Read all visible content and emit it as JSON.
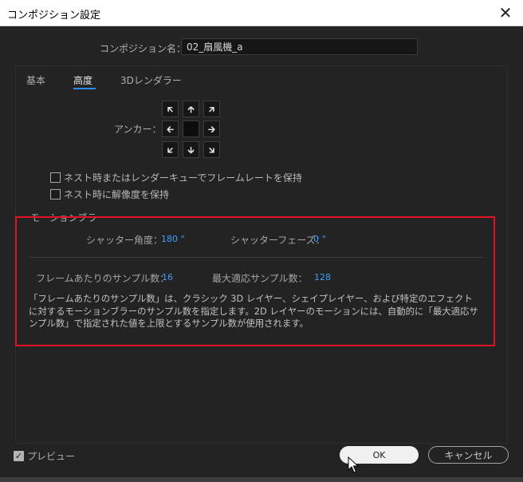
{
  "window": {
    "title": "コンポジション設定",
    "close_glyph": "✕"
  },
  "comp_name": {
    "label": "コンポジション名：",
    "value": "02_扇風機_a"
  },
  "tabs": [
    {
      "label": "基本"
    },
    {
      "label": "高度",
      "active": true
    },
    {
      "label": "3Dレンダラー"
    }
  ],
  "anchor": {
    "label": "アンカー：",
    "buttons": [
      {
        "glyph": "🡴",
        "icon": "arrow-up-left-icon"
      },
      {
        "glyph": "🡱",
        "icon": "arrow-up-icon"
      },
      {
        "glyph": "🡵",
        "icon": "arrow-up-right-icon"
      },
      {
        "glyph": "🡰",
        "icon": "arrow-left-icon"
      },
      {
        "glyph": "",
        "icon": "center-anchor"
      },
      {
        "glyph": "🡲",
        "icon": "arrow-right-icon"
      },
      {
        "glyph": "🡷",
        "icon": "arrow-down-left-icon"
      },
      {
        "glyph": "🡳",
        "icon": "arrow-down-icon"
      },
      {
        "glyph": "🡶",
        "icon": "arrow-down-right-icon"
      }
    ]
  },
  "options": {
    "preserve_frame_rate": "ネスト時またはレンダーキューでフレームレートを保持",
    "preserve_resolution": "ネスト時に解像度を保持"
  },
  "motion_blur": {
    "title": "モーションブラー",
    "shutter_angle_label": "シャッター角度：",
    "shutter_angle_value": "180 °",
    "shutter_phase_label": "シャッターフェーズ：",
    "shutter_phase_value": "0 °",
    "samples_per_frame_label": "フレームあたりのサンプル数：",
    "samples_per_frame_value": "16",
    "adaptive_limit_label": "最大適応サンプル数：",
    "adaptive_limit_value": "128",
    "description": "「フレームあたりのサンプル数」は、クラシック 3D レイヤー、シェイプレイヤー、および特定のエフェクトに対するモーションブラーのサンプル数を指定します。2D レイヤーのモーションには、自動的に「最大適応サンプル数」で指定された値を上限とするサンプル数が使用されます。"
  },
  "footer": {
    "preview_label": "プレビュー",
    "ok_label": "OK",
    "cancel_label": "キャンセル"
  },
  "colors": {
    "accent": "#2d8ceb",
    "value_blue": "#3da0ff",
    "highlight": "#e0141e"
  }
}
